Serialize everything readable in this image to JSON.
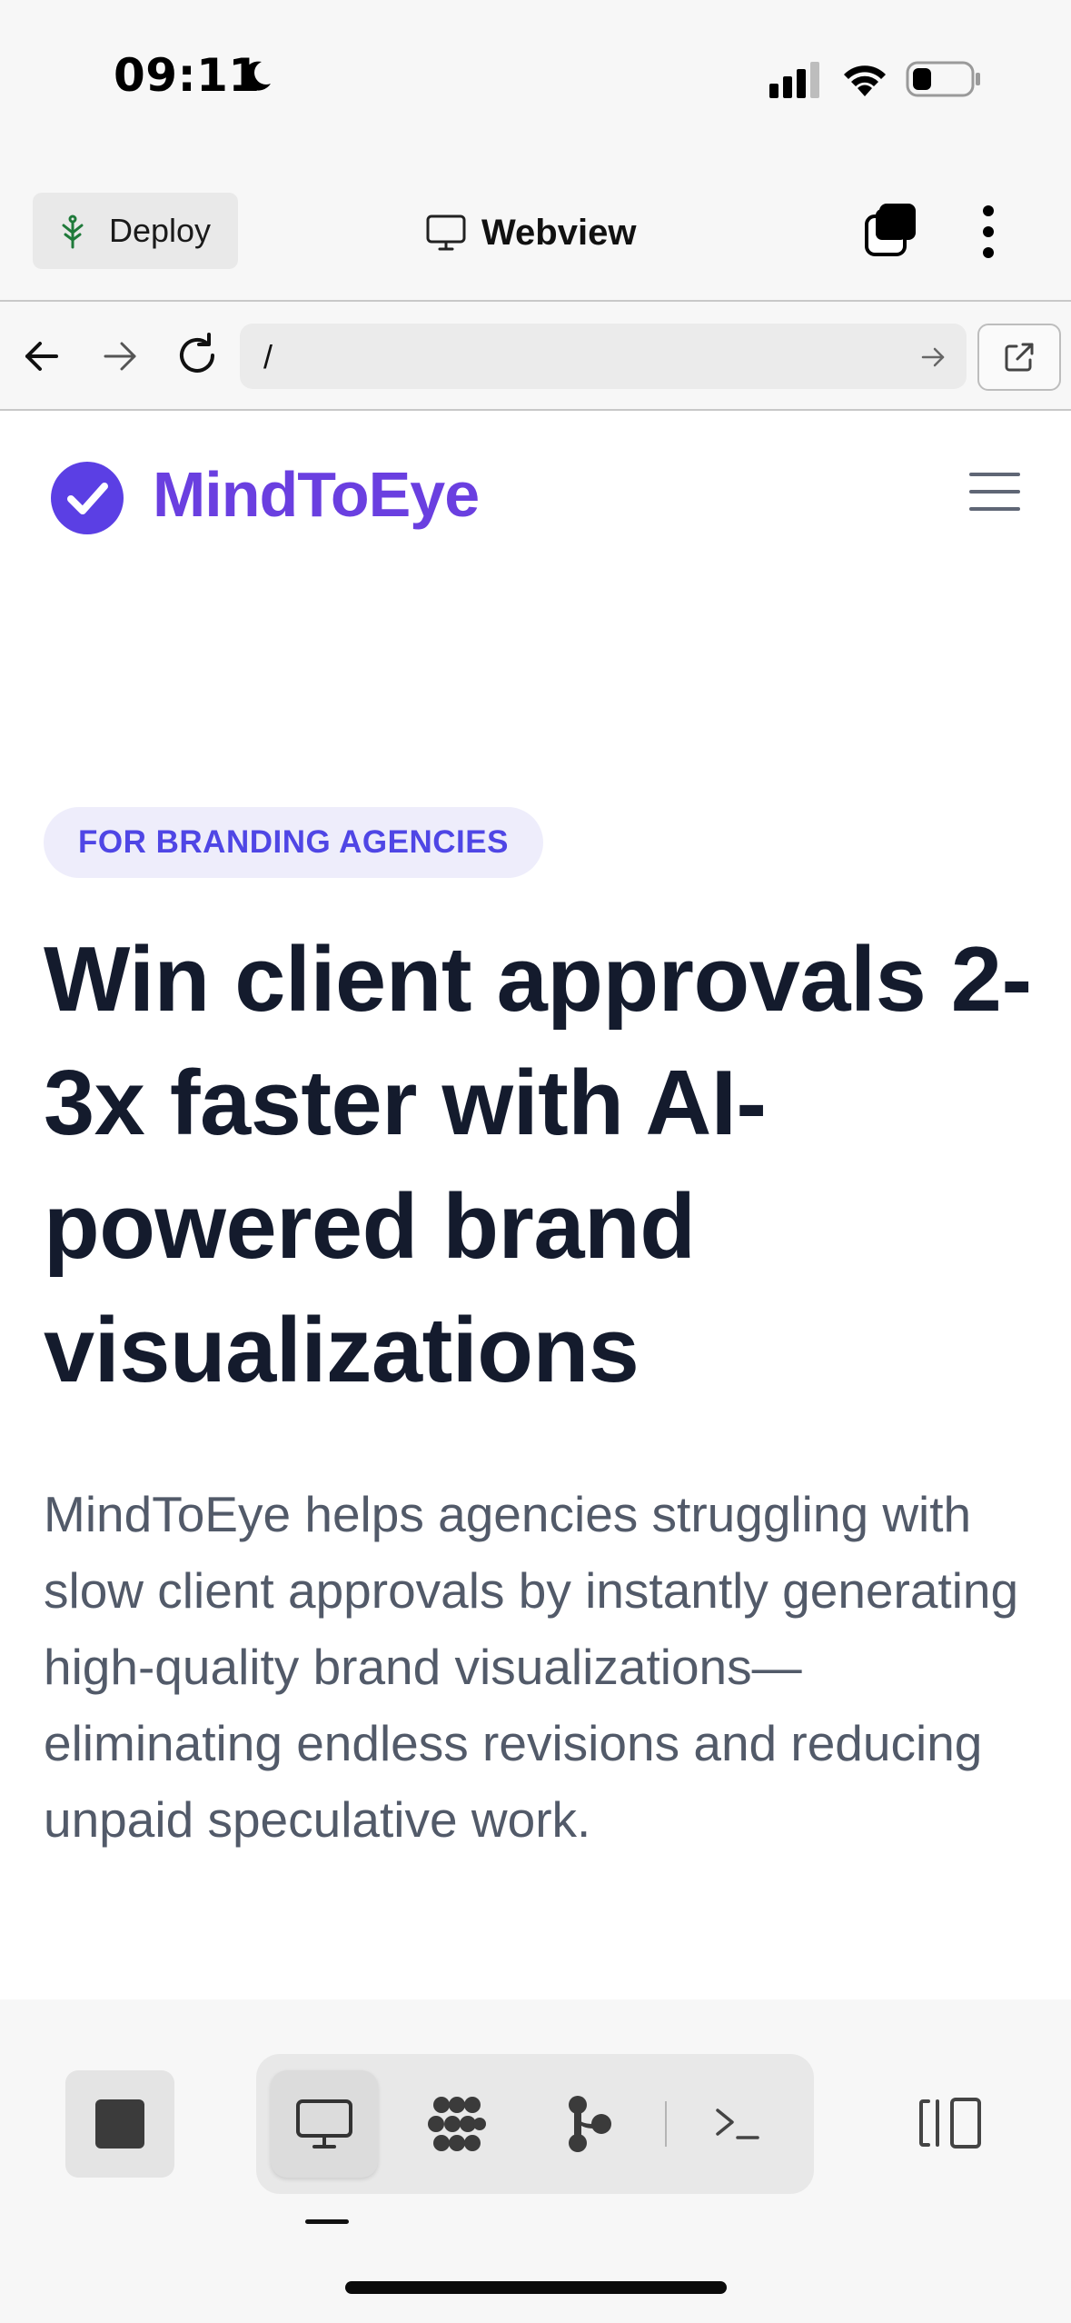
{
  "status_bar": {
    "time": "09:11",
    "icons": [
      "moon-icon",
      "cellular-signal-icon",
      "wifi-icon",
      "battery-icon"
    ]
  },
  "app_toolbar": {
    "deploy_label": "Deploy",
    "title": "Webview",
    "icons": [
      "deploy-tree-icon",
      "monitor-icon",
      "tabs-icon",
      "more-vertical-icon"
    ]
  },
  "url_bar": {
    "url": "/",
    "icons": [
      "back-arrow-icon",
      "forward-arrow-icon",
      "reload-icon",
      "go-arrow-icon",
      "open-external-icon"
    ]
  },
  "site": {
    "brand": "MindToEye",
    "brand_color": "#6a3fe0",
    "badge": "FOR BRANDING AGENCIES",
    "headline": "Win client approvals 2-3x faster with AI-powered brand visualizations",
    "description": "MindToEye helps agencies struggling with slow client approvals by instantly generating high-quality brand visualizations—eliminating endless revisions and reducing unpaid speculative work.",
    "icons": [
      "checkmark-logo-icon",
      "hamburger-menu-icon"
    ]
  },
  "bottom_toolbar": {
    "icons": [
      "stop-icon",
      "webview-monitor-icon",
      "grid-dots-icon",
      "branch-icon",
      "terminal-icon",
      "layout-split-icon"
    ],
    "active_tab": "webview-monitor-icon"
  }
}
